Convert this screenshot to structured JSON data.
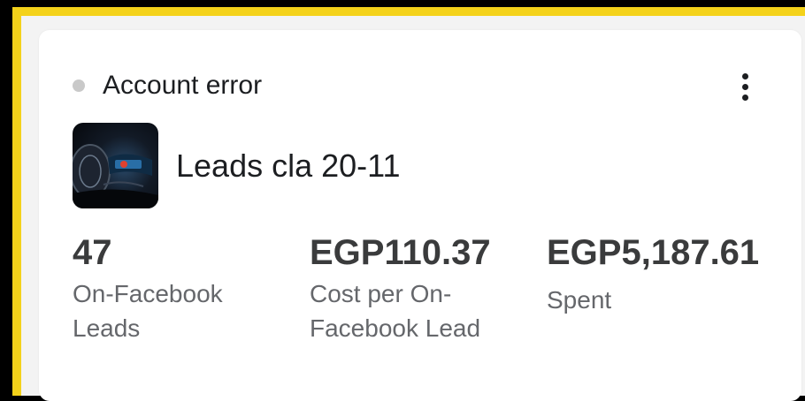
{
  "card": {
    "status": "Account error",
    "campaign_name": "Leads cla 20-11",
    "thumbnail_icon": "car-dashboard-image",
    "more_icon": "more-vertical-icon"
  },
  "metrics": [
    {
      "value": "47",
      "label": "On-Facebook Leads"
    },
    {
      "value": "EGP110.37",
      "label": "Cost per On-Facebook Lead"
    },
    {
      "value": "EGP5,187.61",
      "label": "Spent"
    }
  ],
  "colors": {
    "frame_border": "#f4d21a",
    "status_dot": "#c9c9c9",
    "card_bg": "#ffffff"
  }
}
